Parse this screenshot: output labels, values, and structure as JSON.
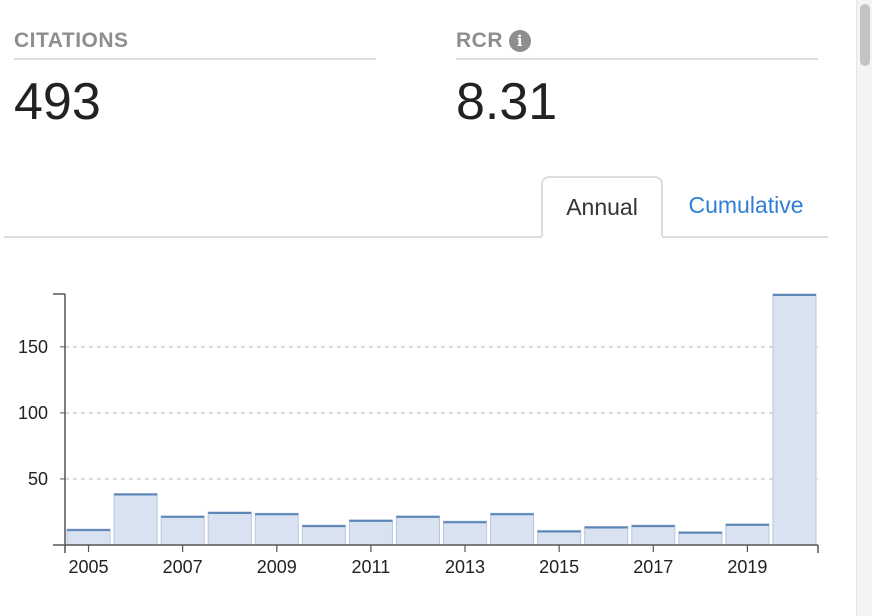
{
  "metrics": {
    "citations": {
      "label": "CITATIONS",
      "value": "493"
    },
    "rcr": {
      "label": "RCR",
      "value": "8.31",
      "info_icon": "info-icon",
      "info_glyph": "i"
    }
  },
  "tabs": [
    {
      "label": "Annual",
      "active": true
    },
    {
      "label": "Cumulative",
      "active": false
    }
  ],
  "colors": {
    "bar_fill": "#d9e2f1",
    "bar_stroke": "#5c86b8",
    "axis": "#555555",
    "grid": "#cfcfcf",
    "tab_link": "#2f7fd6",
    "label_gray": "#8e8e8e"
  },
  "chart_data": {
    "type": "bar",
    "title": "",
    "xlabel": "",
    "ylabel": "",
    "categories": [
      "2005",
      "2006",
      "2007",
      "2008",
      "2009",
      "2010",
      "2011",
      "2012",
      "2013",
      "2014",
      "2015",
      "2016",
      "2017",
      "2018",
      "2019",
      "2020"
    ],
    "values": [
      12,
      39,
      22,
      25,
      24,
      15,
      19,
      22,
      18,
      24,
      11,
      14,
      15,
      10,
      16,
      190
    ],
    "x_tick_labels": [
      "2005",
      "2007",
      "2009",
      "2011",
      "2013",
      "2015",
      "2017",
      "2019"
    ],
    "y_ticks": [
      50,
      100,
      150
    ],
    "y_tick_labels": [
      "50",
      "100",
      "150"
    ],
    "ylim": [
      0,
      190
    ],
    "grid": "horizontal dashed",
    "legend": "none"
  }
}
